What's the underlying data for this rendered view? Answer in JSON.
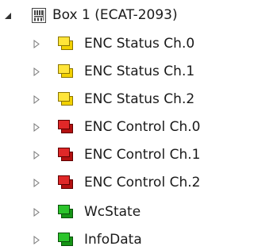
{
  "root": {
    "label": "Box 1 (ECAT-2093)",
    "icon": "ethercat-box-icon",
    "expanded": true
  },
  "items": [
    {
      "label": "ENC Status Ch.0",
      "icon": "input-process-image-icon",
      "color": "#f2d100"
    },
    {
      "label": "ENC Status Ch.1",
      "icon": "input-process-image-icon",
      "color": "#f2d100"
    },
    {
      "label": "ENC Status Ch.2",
      "icon": "input-process-image-icon",
      "color": "#f2d100"
    },
    {
      "label": "ENC Control Ch.0",
      "icon": "output-process-image-icon",
      "color": "#d01818"
    },
    {
      "label": "ENC Control Ch.1",
      "icon": "output-process-image-icon",
      "color": "#d01818"
    },
    {
      "label": "ENC Control Ch.2",
      "icon": "output-process-image-icon",
      "color": "#d01818"
    },
    {
      "label": "WcState",
      "icon": "status-image-icon",
      "color": "#1aaa1a"
    },
    {
      "label": "InfoData",
      "icon": "status-image-icon",
      "color": "#1aaa1a"
    }
  ]
}
